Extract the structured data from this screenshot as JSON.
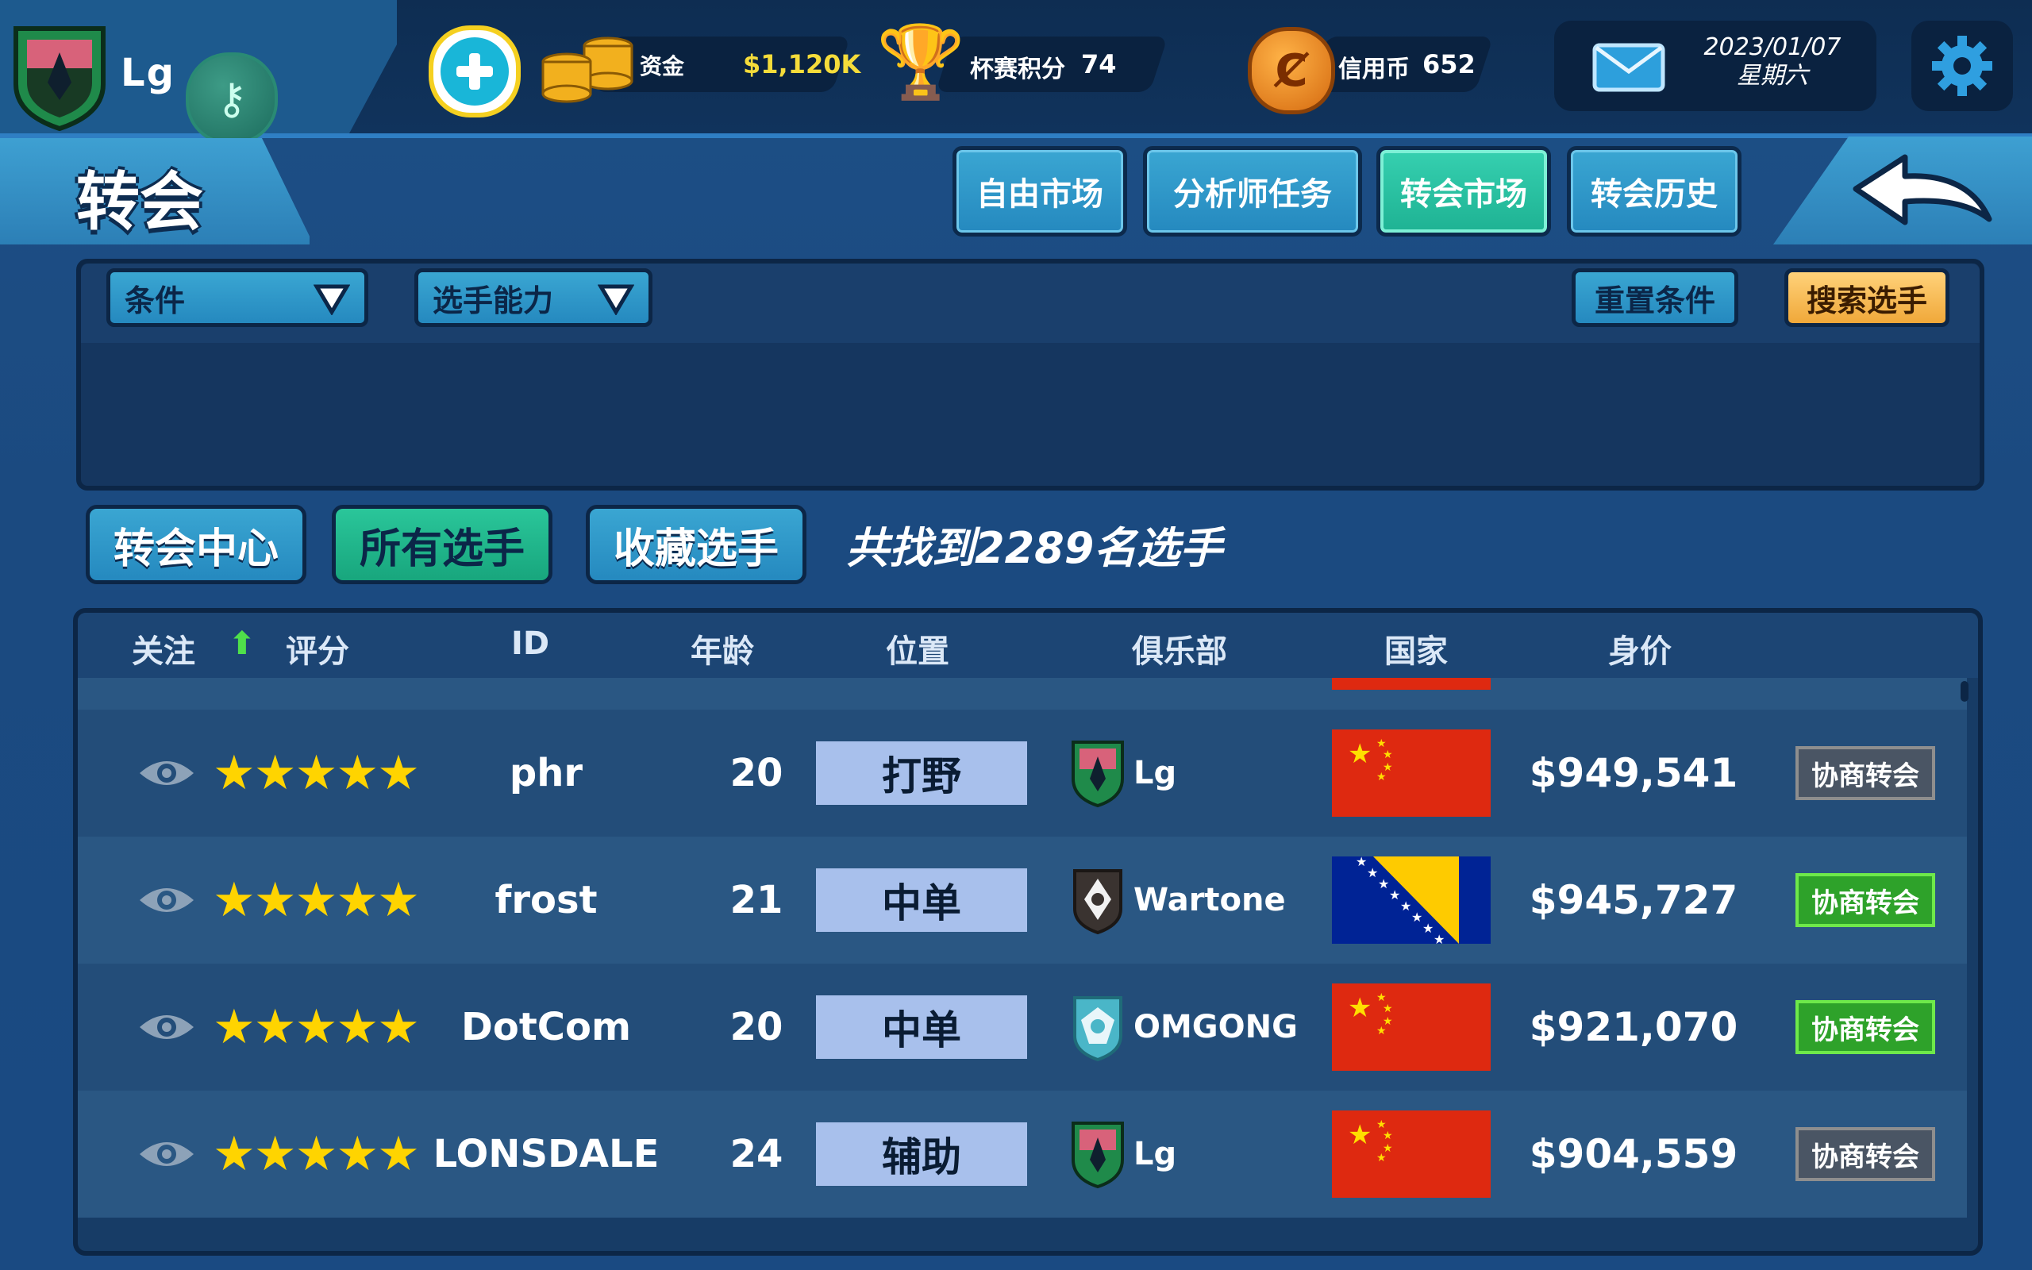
{
  "colors": {
    "accent": "#2ec6a6",
    "topbar": "#0e2d52",
    "panel": "#1d4f86",
    "gold": "#ffd400",
    "green_btn": "#2ea22a",
    "grey_btn": "#4a5564"
  },
  "header": {
    "team_name": "Lg",
    "funds_label": "资金",
    "funds_value": "$1,120K",
    "cup_points_label": "杯赛积分",
    "cup_points_value": "74",
    "credits_label": "信用币",
    "credits_value": "652",
    "date": "2023/01/07",
    "weekday": "星期六"
  },
  "page": {
    "title": "转会",
    "tabs": [
      "自由市场",
      "分析师任务",
      "转会市场",
      "转会历史"
    ],
    "active_tab": 2
  },
  "filters": {
    "condition_label": "条件",
    "ability_label": "选手能力",
    "reset_label": "重置条件",
    "search_label": "搜索选手"
  },
  "list_tabs": {
    "items": [
      "转会中心",
      "所有选手",
      "收藏选手"
    ],
    "active": 1,
    "found_text": "共找到2289名选手"
  },
  "table": {
    "headers": {
      "follow": "关注",
      "rating": "评分",
      "id": "ID",
      "age": "年龄",
      "position": "位置",
      "club": "俱乐部",
      "country": "国家",
      "price": "身价"
    },
    "sort_icon": "arrow-up-icon",
    "action_label": "协商转会",
    "rows": [
      {
        "id": "phr",
        "age": "20",
        "position": "打野",
        "club": "Lg",
        "country": "China",
        "price": "$949,541",
        "stars": 4.5,
        "action_enabled": false
      },
      {
        "id": "frost",
        "age": "21",
        "position": "中单",
        "club": "Wartone",
        "country": "Bosnia and Herzegovina",
        "price": "$945,727",
        "stars": 4.5,
        "action_enabled": true
      },
      {
        "id": "DotCom",
        "age": "20",
        "position": "中单",
        "club": "OMGONG",
        "country": "China",
        "price": "$921,070",
        "stars": 4.5,
        "action_enabled": true
      },
      {
        "id": "LONSDALE",
        "age": "24",
        "position": "辅助",
        "club": "Lg",
        "country": "China",
        "price": "$904,559",
        "stars": 4.5,
        "action_enabled": false
      }
    ]
  }
}
